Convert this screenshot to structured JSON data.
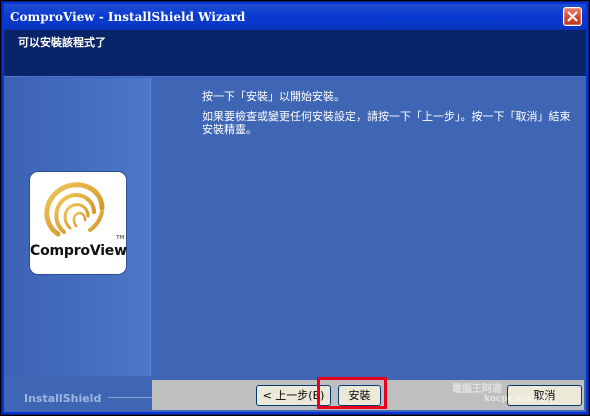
{
  "window": {
    "title": "ComproView - InstallShield Wizard"
  },
  "header": {
    "title": "可以安裝該程式了"
  },
  "body": {
    "instruction": "按一下「安裝」以開始安裝。",
    "details": "如果要檢查或變更任何安裝設定，請按一下「上一步」。按一下「取消」結束安裝精靈。"
  },
  "logo": {
    "text": "ComproView",
    "tm": "TM"
  },
  "footer": {
    "brand": "InstallShield",
    "back_label": "< 上一步(B)",
    "install_label": "安裝",
    "cancel_label": "取消"
  },
  "watermark": {
    "line1": "電腦王阿達",
    "line2": "kocpc.com.tw"
  },
  "colors": {
    "title_bar": "#0a3bd1",
    "header_bg": "#0a246a",
    "body_bg": "#3f66b5",
    "highlight": "#e8001c",
    "logo_gold": "#d9a23a"
  },
  "icons": [
    "close-icon",
    "comproview-logo-icon"
  ]
}
